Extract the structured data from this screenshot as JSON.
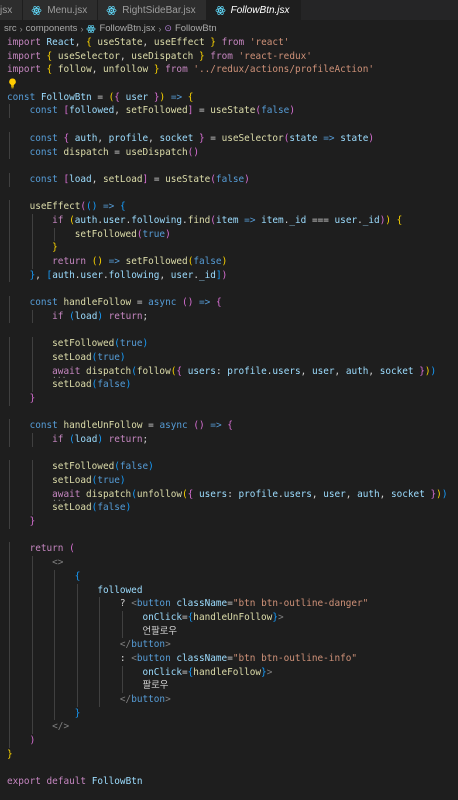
{
  "tabs": [
    {
      "label": "jsx",
      "active": false
    },
    {
      "label": "Menu.jsx",
      "active": false
    },
    {
      "label": "RightSideBar.jsx",
      "active": false
    },
    {
      "label": "FollowBtn.jsx",
      "active": true
    }
  ],
  "breadcrumb": [
    "src",
    "components",
    "FollowBtn.jsx",
    "FollowBtn"
  ],
  "code_lines": [
    "import React, { useState, useEffect } from 'react'",
    "import { useSelector, useDispatch } from 'react-redux'",
    "import { follow, unfollow } from '../redux/actions/profileAction'",
    "",
    "const FollowBtn = ({ user }) => {",
    "    const [followed, setFollowed] = useState(false)",
    "",
    "    const { auth, profile, socket } = useSelector(state => state)",
    "    const dispatch = useDispatch()",
    "",
    "    const [load, setLoad] = useState(false)",
    "",
    "    useEffect(() => {",
    "        if (auth.user.following.find(item => item._id === user._id)) {",
    "            setFollowed(true)",
    "        }",
    "        return () => setFollowed(false)",
    "    }, [auth.user.following, user._id])",
    "",
    "    const handleFollow = async () => {",
    "        if (load) return;",
    "",
    "        setFollowed(true)",
    "        setLoad(true)",
    "        await dispatch(follow({ users: profile.users, user, auth, socket }))",
    "        setLoad(false)",
    "    }",
    "",
    "    const handleUnFollow = async () => {",
    "        if (load) return;",
    "",
    "        setFollowed(false)",
    "        setLoad(true)",
    "        await dispatch(unfollow({ users: profile.users, user, auth, socket }))",
    "        setLoad(false)",
    "    }",
    "",
    "    return (",
    "        <>",
    "            {",
    "                followed",
    "                    ? <button className=\"btn btn-outline-danger\"",
    "                        onClick={handleUnFollow}>",
    "                        언팔로우",
    "                    </button>",
    "                    : <button className=\"btn btn-outline-info\"",
    "                        onClick={handleFollow}>",
    "                        팔로우",
    "                    </button>",
    "            }",
    "        </>",
    "    )",
    "}",
    "",
    "export default FollowBtn"
  ],
  "colors": {
    "background": "#1e1e1e",
    "keyword": "#c586c0",
    "declaration": "#569cd6",
    "function": "#dcdcaa",
    "variable": "#9cdcfe",
    "class": "#4ec9b0",
    "string": "#ce9178",
    "bracket_level_1": "#ffd700",
    "bracket_level_2": "#da70d6",
    "bracket_level_3": "#179fff"
  },
  "icons": {
    "tab": "react-icon",
    "breadcrumb": "react-icon",
    "gutter": "lightbulb-icon"
  }
}
